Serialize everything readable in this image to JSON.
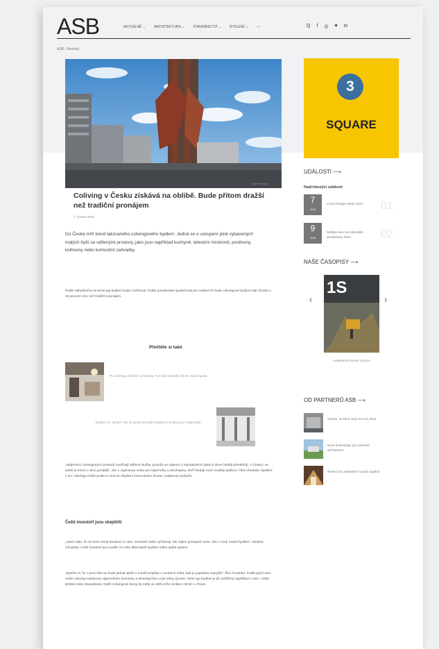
{
  "header": {
    "logo": "ASB",
    "nav": [
      "AKTUÁLNĚ ⌄",
      "ARCHITEKTURA ⌄",
      "STAVEBNICTVÍ ⌄",
      "BYDLENÍ ⌄",
      "—"
    ],
    "icons": [
      "search-icon",
      "facebook-icon",
      "instagram-icon",
      "twitter-icon",
      "linkedin-icon"
    ],
    "icon_glyphs": {
      "search": "Q",
      "facebook": "f",
      "instagram": "◎",
      "twitter": "♥",
      "linkedin": "in"
    }
  },
  "breadcrumb": "ASB › Novinky",
  "article": {
    "photo_credit": "Foto: Freepik",
    "title": "Coliving v Česku získává na oblibě. Bude přitom dražší než tradiční pronájem",
    "date": "7. června 2023",
    "lead": "Do Česka míří trend takzvaného colivingového bydlení. Jedná se o uskupení plně vybavených malých bytů se sdílenými prostory, jako jsou například kuchyně, televizní místnosti, posilovny, knihovny nebo komunitní zahrádky.",
    "p1": "Podle odhadů trhu se tento typ bydlení bude rozšiřovat. Podle poradenské společnosti pro realitní trh bude colivingové bydlení stát zhruba o 15 procent více než tradiční pronájem.",
    "read_also": "Přečtěte si také",
    "related": [
      {
        "text": "Po colivingu přichází cohousing. Rozvíjet zahrady zdá se, mají nápady."
      },
      {
        "text": "Bydlení 21. století? Jak se spojit komunitní bydlení s prostory pro nájemníky."
      }
    ],
    "p2": "„Nájemníci colivingových prostorů využívají sdílené služby, protože se nájemci v standardních bytech dnes častěji přestěhují. V Česku i ve světě je trend o něco pozdější. Jde o zajímavou cestu pro nájemníky a developery, kteří hledají nové modely bydlení,“ říká Chudoba. Bydlení v tzv. colivingu může podle ní vést ke zlepšení komunitního života i vzájemné podpoře.",
    "subhead": "Čeští investoři jsou skeptičtí",
    "p3": "„Jsem ráda, že se tento trend dostává i k nám. Investoři zatím vyčkávají, ale zájem postupně roste. Jde o nový model bydlení,“ dodává Chudoba. Čeští investoři jsou podle ní k této alternativě bydlení zatím spíše opatrní.",
    "p4": "„Myslím si, že v první fázi se bude jednat spíše o menší projekty v centrech měst, kde je poptávka nejvyšší,“ říká Chudoba. Podle jejích slov může coliving nabídnout nájemníkům komunitu a developerům nový zdroj výnosů. Tento typ bydlení je již rozšířený například v USA, Velké Británii nebo Skandinávii. Další colivingové domy by měly ve větší míře vznikat v Brně i v Praze."
  },
  "sidebar": {
    "ad": {
      "number": "3",
      "text": "SQUARE"
    },
    "events_heading": "UDÁLOSTI ⟶",
    "events_sub": "Nadcházející události",
    "events": [
      {
        "day": "7",
        "month": "JUN",
        "title": "Czech Design Week 2023",
        "num": "01"
      },
      {
        "day": "9",
        "month": "JUN",
        "title": "Sdílejte akce do kalendáře architektury 2023",
        "num": "02"
      }
    ],
    "magazines_heading": "NAŠE ČASOPISY ⟶",
    "magazine_cover_text": "1S",
    "magazine_caption": "KOMERČNÍ STAVBY 04/2023",
    "partners_heading": "OD PARTNERŮ ASB ⟶",
    "partners": [
      {
        "text": "Stavba, ze které stojí za to se dívat"
      },
      {
        "text": "Nová technologie pro zahradní architekturu"
      },
      {
        "text": "Řešení pro zastřešení nových objektů"
      }
    ]
  }
}
